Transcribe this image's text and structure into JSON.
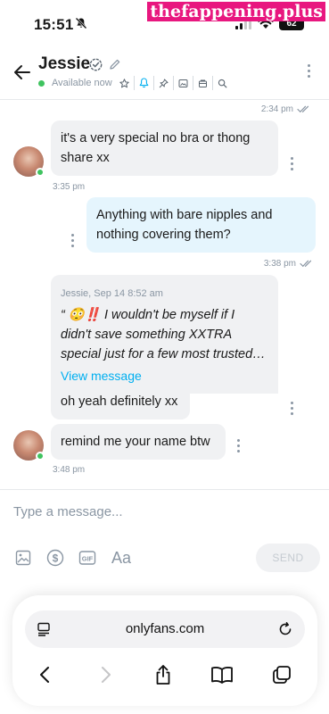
{
  "status_bar": {
    "time": "15:51",
    "battery": "62"
  },
  "watermark": "thefappening.plus",
  "header": {
    "name": "Jessie",
    "availability": "Available now"
  },
  "messages": [
    {
      "id": "m0",
      "meta": "2:34 pm"
    },
    {
      "id": "m1",
      "text": "it's a very special no bra or thong share xx",
      "time": "3:35 pm"
    },
    {
      "id": "m2",
      "text": "Anything with bare nipples and nothing covering them?",
      "time": "3:38 pm"
    },
    {
      "id": "m3",
      "quote_head": "Jessie, Sep 14 8:52 am",
      "quote_text": "“ 😳‼️ I wouldn't be myself if I didn't save something XXTRA special just for a few most trusted…",
      "link": "View message"
    },
    {
      "id": "m4",
      "text": "oh yeah definitely xx"
    },
    {
      "id": "m5",
      "text": "remind me your name btw",
      "time": "3:48 pm"
    }
  ],
  "composer": {
    "placeholder": "Type a message...",
    "send_label": "SEND",
    "text_tool": "Aa"
  },
  "browser": {
    "url": "onlyfans.com"
  },
  "colors": {
    "accent": "#00aff0",
    "online": "#3fc35f",
    "incoming_bubble": "#f0f1f3",
    "outgoing_bubble": "#e5f5fd"
  }
}
